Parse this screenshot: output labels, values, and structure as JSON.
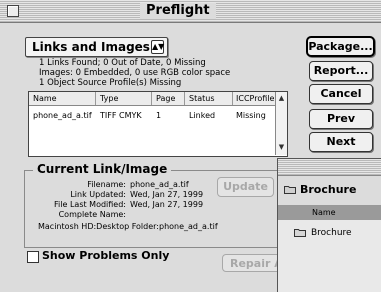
{
  "window": {
    "title": "Preflight"
  },
  "dropdown": {
    "selected": "Links and Images"
  },
  "summary": [
    "1 Links Found; 0 Out of Date, 0 Missing",
    "Images: 0 Embedded, 0 use RGB color space",
    "1 Object Source Profile(s) Missing"
  ],
  "table": {
    "columns": [
      "Name",
      "Type",
      "Page",
      "Status",
      "ICCProfile"
    ],
    "rows": [
      [
        "phone_ad_a.tif",
        "TIFF CMYK",
        "1",
        "Linked",
        "Missing"
      ]
    ]
  },
  "current_link": {
    "title": "Current Link/Image",
    "fields": [
      {
        "label": "Filename:",
        "value": "phone_ad_a.tif"
      },
      {
        "label": "Link Updated:",
        "value": "Wed, Jan 27, 1999"
      },
      {
        "label": "File Last Modified:",
        "value": "Wed, Jan 27, 1999"
      },
      {
        "label": "Complete Name:",
        "value": ""
      }
    ],
    "path": "Macintosh HD:Desktop Folder:phone_ad_a.tif",
    "update_label": "Update"
  },
  "buttons": {
    "package": "Package...",
    "report": "Report...",
    "cancel": "Cancel",
    "prev": "Prev",
    "next": "Next",
    "repair": "Repair A"
  },
  "show_problems": {
    "label": "Show Problems Only",
    "checked": false
  },
  "brochure_window": {
    "title": "Brochure",
    "column": "Name",
    "items": [
      "Brochure"
    ]
  },
  "icons": [
    "close-box-icon",
    "popup-arrows-icon",
    "scroll-up-icon",
    "scroll-down-icon",
    "folder-icon"
  ]
}
